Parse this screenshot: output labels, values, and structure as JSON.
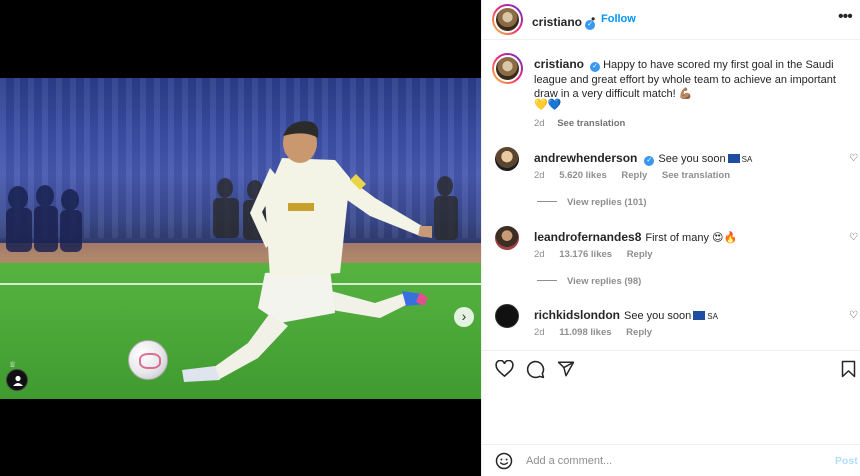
{
  "post": {
    "username": "cristiano",
    "follow_label": "Follow",
    "separator": "•",
    "caption": "Happy to have scored my first goal in the Saudi league and great effort by whole team to achieve an important draw in a very difficult match!",
    "caption_emoji": "💪🏽",
    "hearts_emoji": "💛💙",
    "time": "2d",
    "see_translation": "See translation"
  },
  "comments": [
    {
      "username": "andrewhenderson",
      "verified": true,
      "text": "See you soon",
      "flag_code": "SA",
      "time": "2d",
      "likes": "5.620 likes",
      "reply": "Reply",
      "see_translation": "See translation",
      "replies": "View replies (101)"
    },
    {
      "username": "leandrofernandes8",
      "text": "First of many",
      "emoji": "😍🔥",
      "time": "2d",
      "likes": "13.176 likes",
      "reply": "Reply",
      "replies": "View replies (98)"
    },
    {
      "username": "richkidslondon",
      "text": "See you soon",
      "flag_code": "SA",
      "time": "2d",
      "likes": "11.098 likes",
      "reply": "Reply"
    }
  ],
  "composer": {
    "placeholder": "Add a comment...",
    "post_label": "Post"
  },
  "carousel": {
    "slide_count": 4,
    "active_index": 0
  },
  "colors": {
    "accent": "#0095f6",
    "verified": "#3897f0",
    "muted": "#8e8e8e"
  }
}
